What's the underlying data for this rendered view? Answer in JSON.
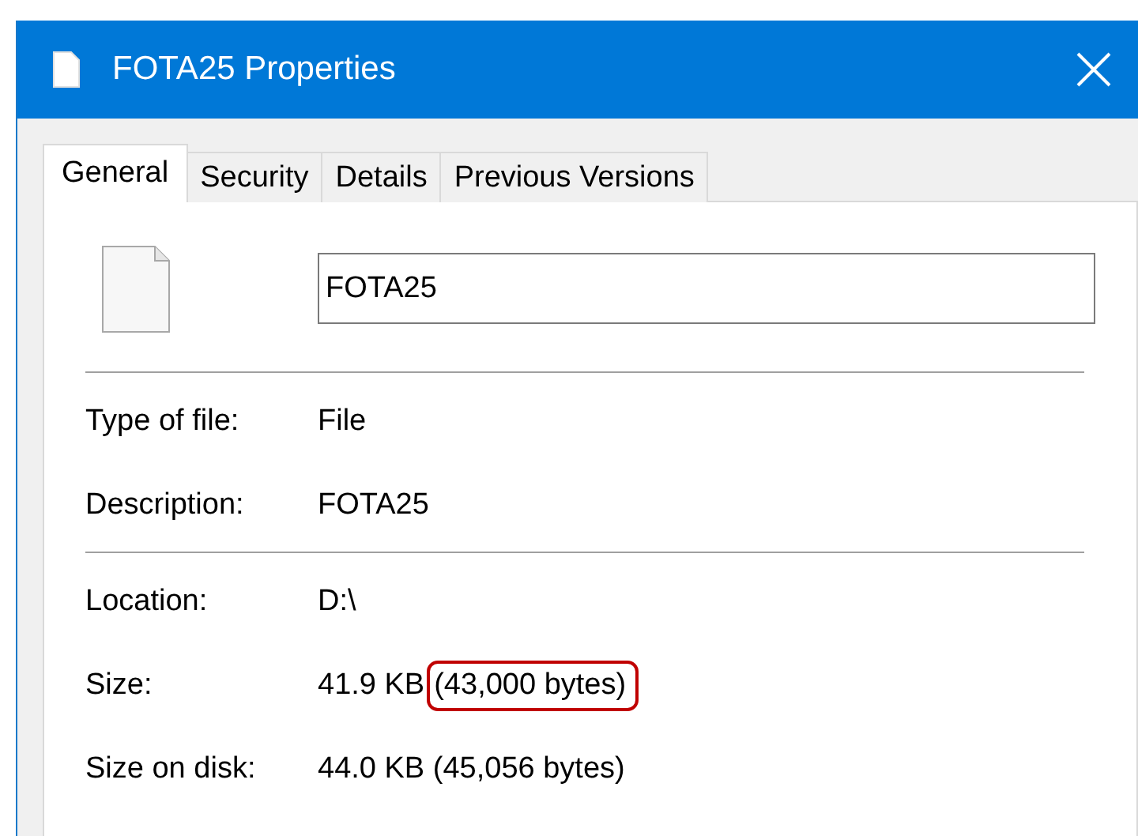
{
  "window": {
    "title": "FOTA25 Properties"
  },
  "tabs": [
    {
      "label": "General",
      "selected": true
    },
    {
      "label": "Security",
      "selected": false
    },
    {
      "label": "Details",
      "selected": false
    },
    {
      "label": "Previous Versions",
      "selected": false
    }
  ],
  "general": {
    "file_name": "FOTA25",
    "sections": [
      {
        "rows": [
          {
            "label": "Type of file:",
            "value_parts": [
              {
                "text": "File",
                "highlighted": false
              }
            ]
          },
          {
            "label": "Description:",
            "value_parts": [
              {
                "text": "FOTA25",
                "highlighted": false
              }
            ]
          }
        ]
      },
      {
        "rows": [
          {
            "label": "Location:",
            "value_parts": [
              {
                "text": "D:\\",
                "highlighted": false
              }
            ]
          },
          {
            "label": "Size:",
            "value_parts": [
              {
                "text": "41.9 KB",
                "highlighted": false
              },
              {
                "text": "(43,000 bytes)",
                "highlighted": true
              }
            ]
          },
          {
            "label": "Size on disk:",
            "value_parts": [
              {
                "text": "44.0 KB (45,056 bytes)",
                "highlighted": false
              }
            ]
          }
        ]
      }
    ]
  }
}
